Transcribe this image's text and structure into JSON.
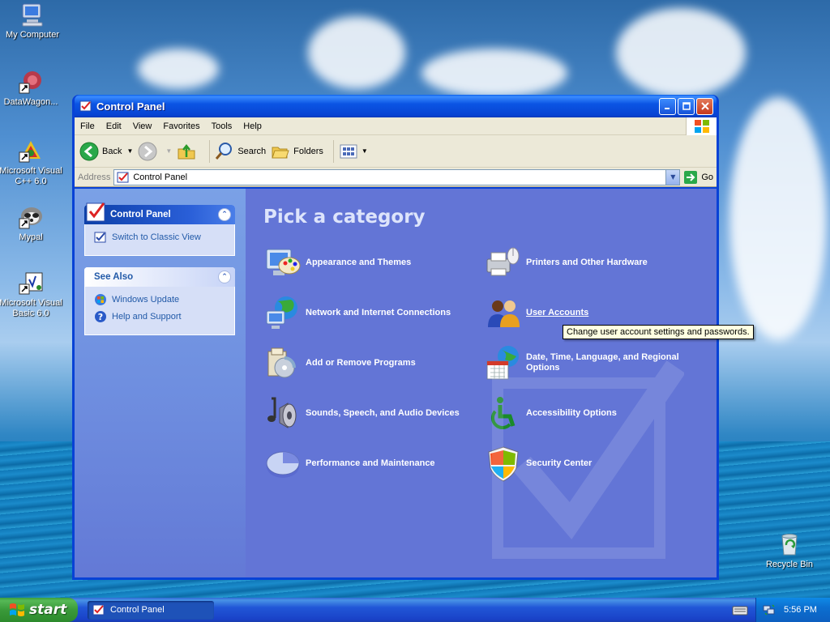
{
  "desktop": {
    "icons": [
      {
        "label": "My Computer",
        "icon": "my-computer-icon"
      },
      {
        "label": "DataWagon...",
        "icon": "datawagon-icon"
      },
      {
        "label": "Microsoft Visual C++ 6.0",
        "icon": "visual-cpp-icon"
      },
      {
        "label": "Mypal",
        "icon": "mypal-icon"
      },
      {
        "label": "Microsoft Visual Basic 6.0",
        "icon": "visual-basic-icon"
      },
      {
        "label": "Recycle Bin",
        "icon": "recycle-bin-icon"
      }
    ]
  },
  "window": {
    "title": "Control Panel",
    "menu": [
      "File",
      "Edit",
      "View",
      "Favorites",
      "Tools",
      "Help"
    ],
    "toolbar": {
      "back": "Back",
      "search": "Search",
      "folders": "Folders"
    },
    "address": {
      "label": "Address",
      "value": "Control Panel",
      "go": "Go"
    }
  },
  "leftpane": {
    "panel1": {
      "title": "Control Panel",
      "links": [
        "Switch to Classic View"
      ]
    },
    "panel2": {
      "title": "See Also",
      "links": [
        "Windows Update",
        "Help and Support"
      ]
    }
  },
  "main": {
    "heading": "Pick a category",
    "categories": [
      "Appearance and Themes",
      "Printers and Other Hardware",
      "Network and Internet Connections",
      "User Accounts",
      "Add or Remove Programs",
      "Date, Time, Language, and Regional Options",
      "Sounds, Speech, and Audio Devices",
      "Accessibility Options",
      "Performance and Maintenance",
      "Security Center"
    ],
    "tooltip": "Change user account settings and passwords."
  },
  "taskbar": {
    "start": "start",
    "task": "Control Panel",
    "clock": "5:56 PM"
  },
  "colors": {
    "xp_blue": "#0842d6",
    "pane_blue": "#6375d6",
    "start_green": "#3a9a3a"
  }
}
